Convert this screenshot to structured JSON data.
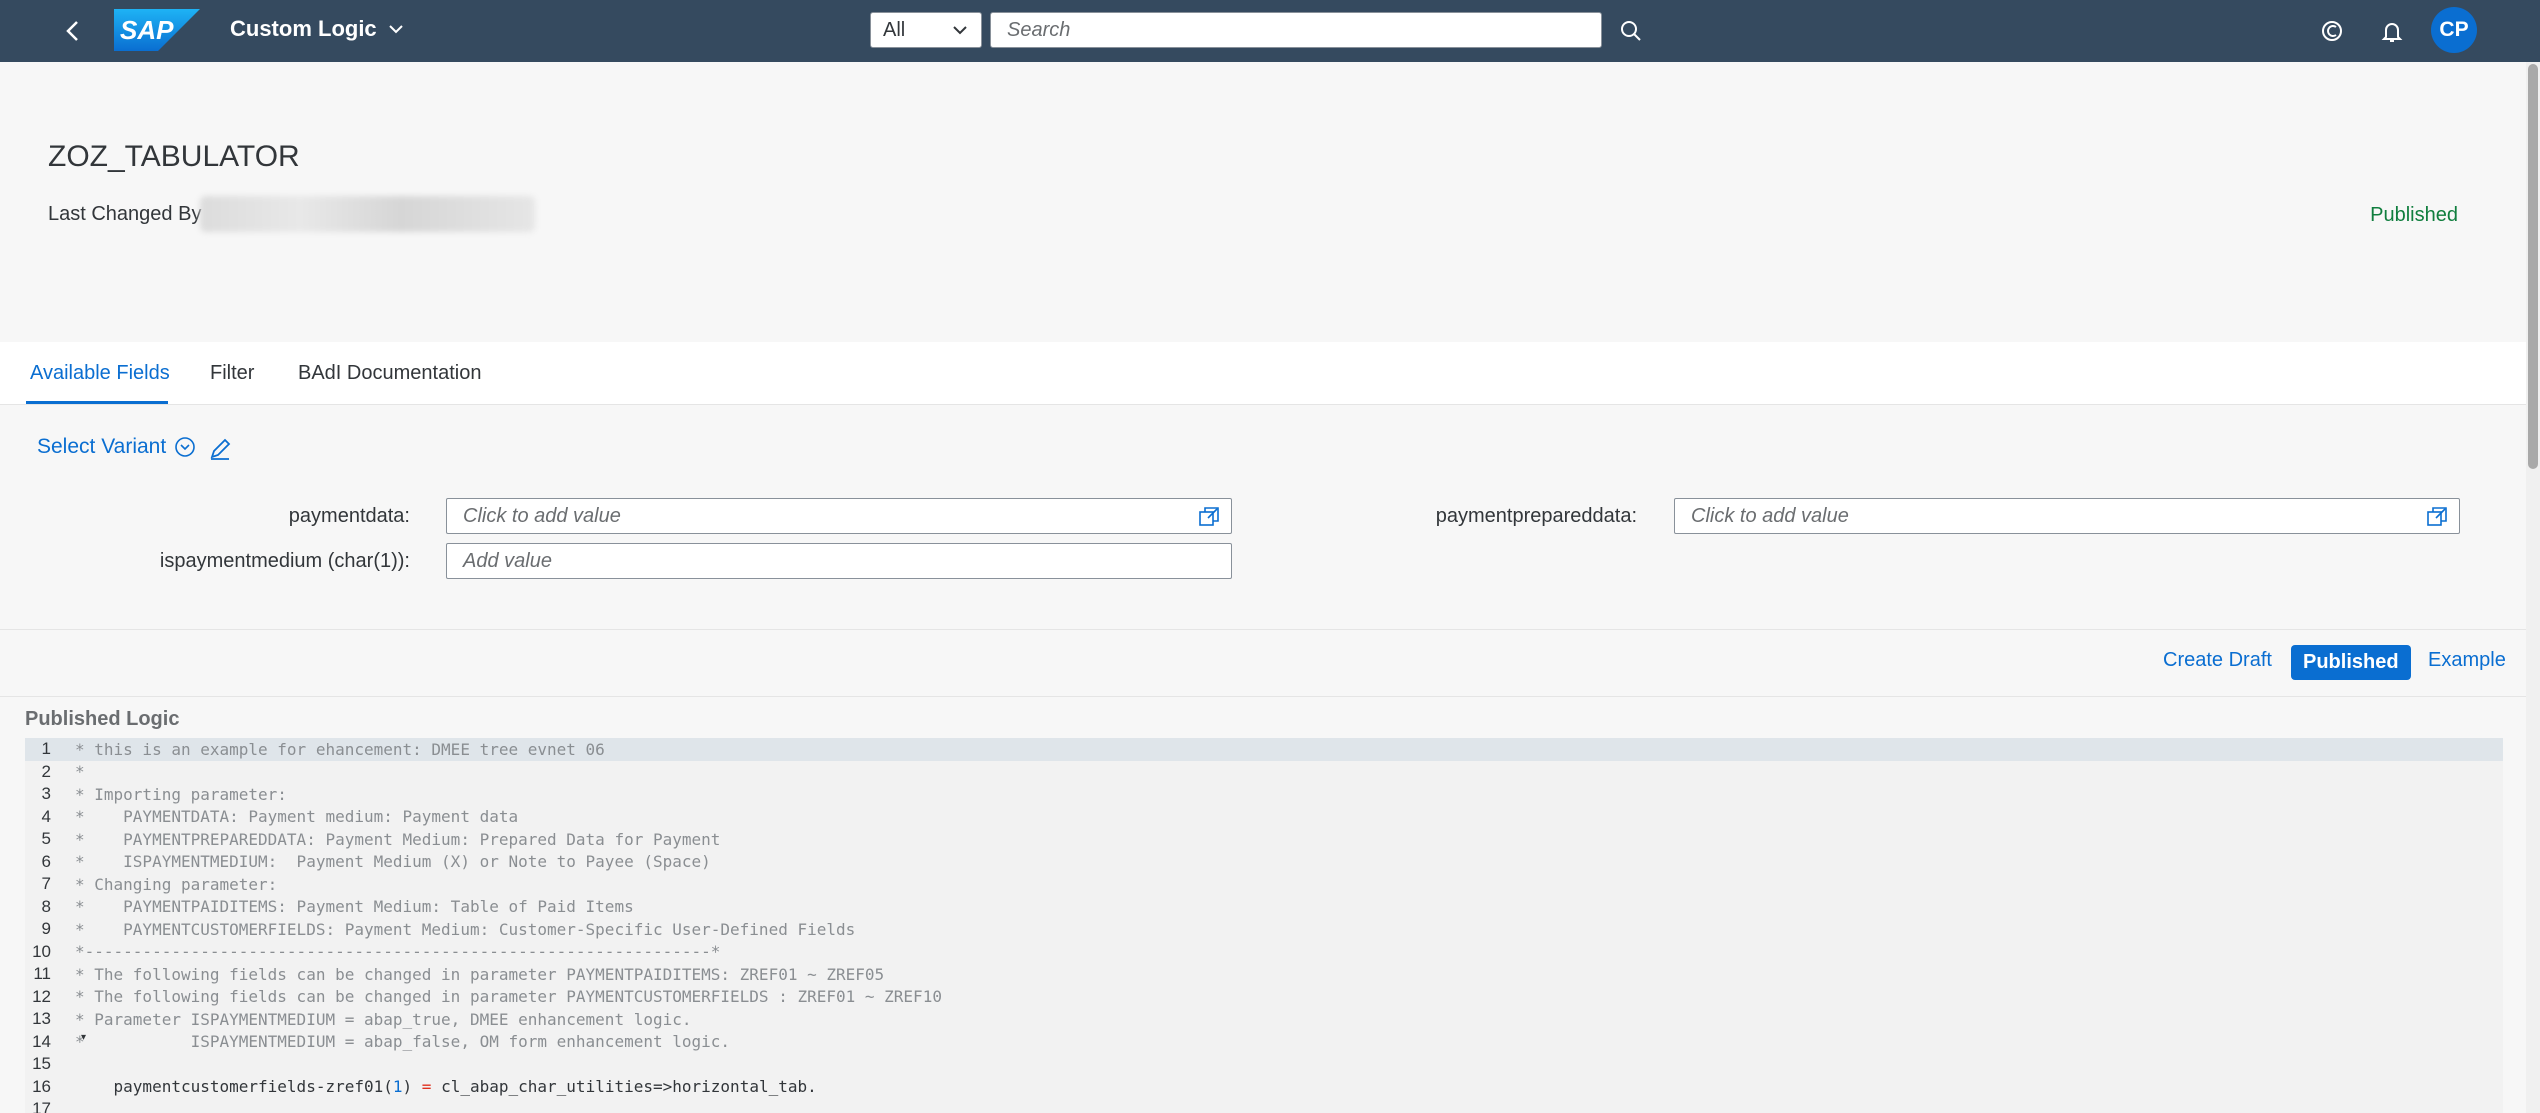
{
  "shell": {
    "brand": "SAP",
    "app_title": "Custom Logic",
    "scope_value": "All",
    "search_placeholder": "Search",
    "avatar_initials": "CP"
  },
  "header": {
    "title": "ZOZ_TABULATOR",
    "last_changed_label": "Last Changed By",
    "status": "Published"
  },
  "tabs": [
    {
      "label": "Available Fields"
    },
    {
      "label": "Filter"
    },
    {
      "label": "BAdI Documentation"
    }
  ],
  "filter": {
    "variant_label": "Select Variant",
    "fields": [
      {
        "label": "paymentdata:",
        "placeholder": "Click to add value"
      },
      {
        "label": "ispaymentmedium (char(1)):",
        "placeholder": "Add value"
      },
      {
        "label": "paymentprepareddata:",
        "placeholder": "Click to add value"
      }
    ]
  },
  "toolbar": {
    "create_draft": "Create Draft",
    "published": "Published",
    "example": "Example"
  },
  "logic": {
    "title": "Published Logic",
    "lines": [
      {
        "num": "1",
        "text": "* this is an example for ehancement: DMEE tree evnet 06"
      },
      {
        "num": "2",
        "text": "*"
      },
      {
        "num": "3",
        "text": "* Importing parameter:"
      },
      {
        "num": "4",
        "text": "*    PAYMENTDATA: Payment medium: Payment data"
      },
      {
        "num": "5",
        "text": "*    PAYMENTPREPAREDDATA: Payment Medium: Prepared Data for Payment"
      },
      {
        "num": "6",
        "text": "*    ISPAYMENTMEDIUM:  Payment Medium (X) or Note to Payee (Space)"
      },
      {
        "num": "7",
        "text": "* Changing parameter:"
      },
      {
        "num": "8",
        "text": "*    PAYMENTPAIDITEMS: Payment Medium: Table of Paid Items"
      },
      {
        "num": "9",
        "text": "*    PAYMENTCUSTOMERFIELDS: Payment Medium: Customer-Specific User-Defined Fields"
      },
      {
        "num": "10",
        "text": "*-----------------------------------------------------------------*"
      },
      {
        "num": "11",
        "text": "* The following fields can be changed in parameter PAYMENTPAIDITEMS: ZREF01 ~ ZREF05"
      },
      {
        "num": "12",
        "text": "* The following fields can be changed in parameter PAYMENTCUSTOMERFIELDS : ZREF01 ~ ZREF10"
      },
      {
        "num": "13",
        "text": "* Parameter ISPAYMENTMEDIUM = abap_true, DMEE enhancement logic."
      },
      {
        "num": "14",
        "text": "*           ISPAYMENTMEDIUM = abap_false, OM form enhancement logic."
      },
      {
        "num": "15",
        "text": ""
      },
      {
        "num": "16",
        "text": ""
      },
      {
        "num": "17",
        "text": ""
      }
    ],
    "stmt_parts": [
      "    paymentcustomerfields-zref01(",
      "1",
      ") ",
      "=",
      " cl_abap_char_utilities=>horizontal_tab."
    ]
  }
}
